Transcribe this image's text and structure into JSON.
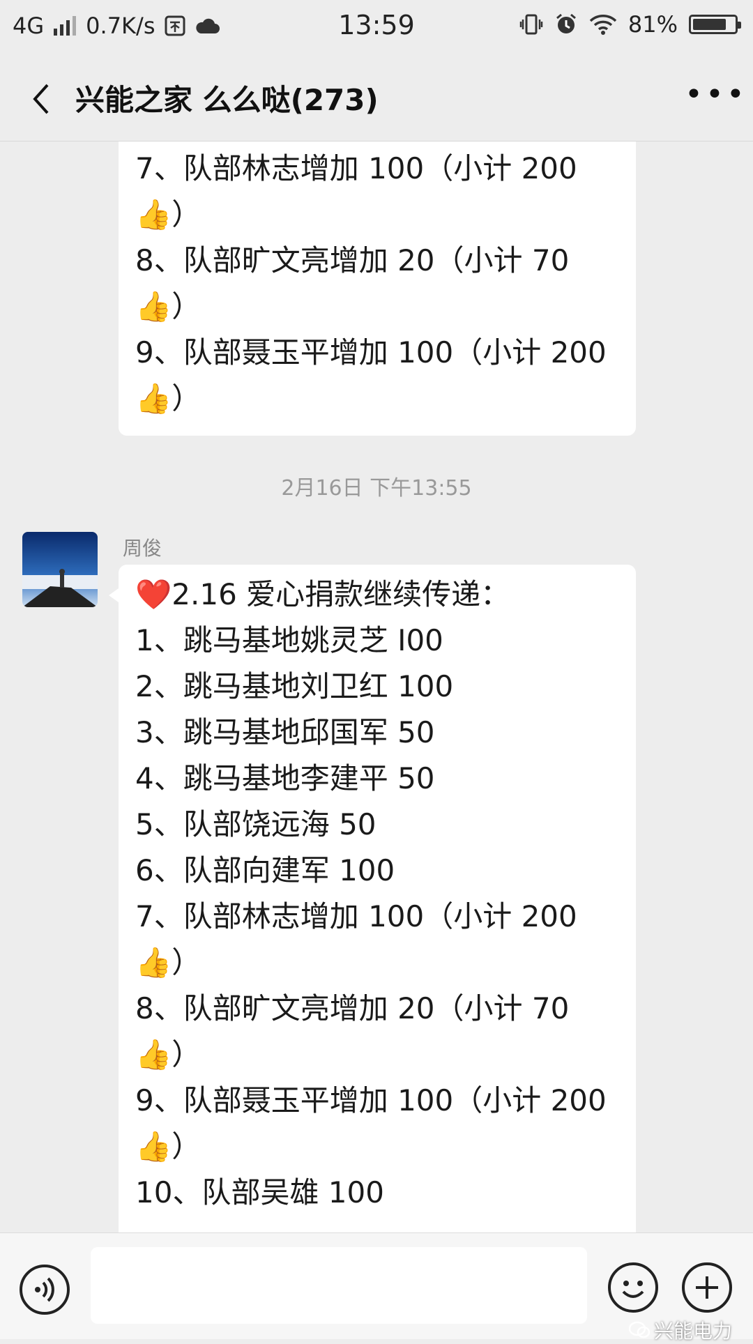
{
  "status_bar": {
    "network": "4G",
    "speed": "0.7K/s",
    "time": "13:59",
    "battery": "81%",
    "battery_level": 0.81
  },
  "header": {
    "title": "兴能之家 么么哒(273)"
  },
  "messages": {
    "prev_bubble": {
      "lines": [
        "7、队部林志增加 100（小计 200",
        "）",
        "8、队部旷文亮增加 20（小计 70",
        "）",
        "9、队部聂玉平增加 100（小计 200",
        "）"
      ]
    },
    "timestamp": "2月16日 下午13:55",
    "sender": "周俊",
    "bubble": {
      "lines": [
        "2.16 爱心捐款继续传递：",
        "1、跳马基地姚灵芝 I00",
        "2、跳马基地刘卫红 100",
        "3、跳马基地邱国军 50",
        "4、跳马基地李建平 50",
        "5、队部饶远海 50",
        "6、队部向建军 100",
        "7、队部林志增加 100（小计 200",
        "）",
        "8、队部旷文亮增加 20（小计 70",
        "）",
        "9、队部聂玉平增加 100（小计 200",
        "）",
        "10、队部吴雄 100"
      ]
    }
  },
  "emoji": {
    "heart": "❤️",
    "thumbs": "👍"
  },
  "watermark": "兴能电力",
  "colors": {
    "background": "#ededed",
    "bubble": "#ffffff",
    "timestamp": "#999999"
  }
}
